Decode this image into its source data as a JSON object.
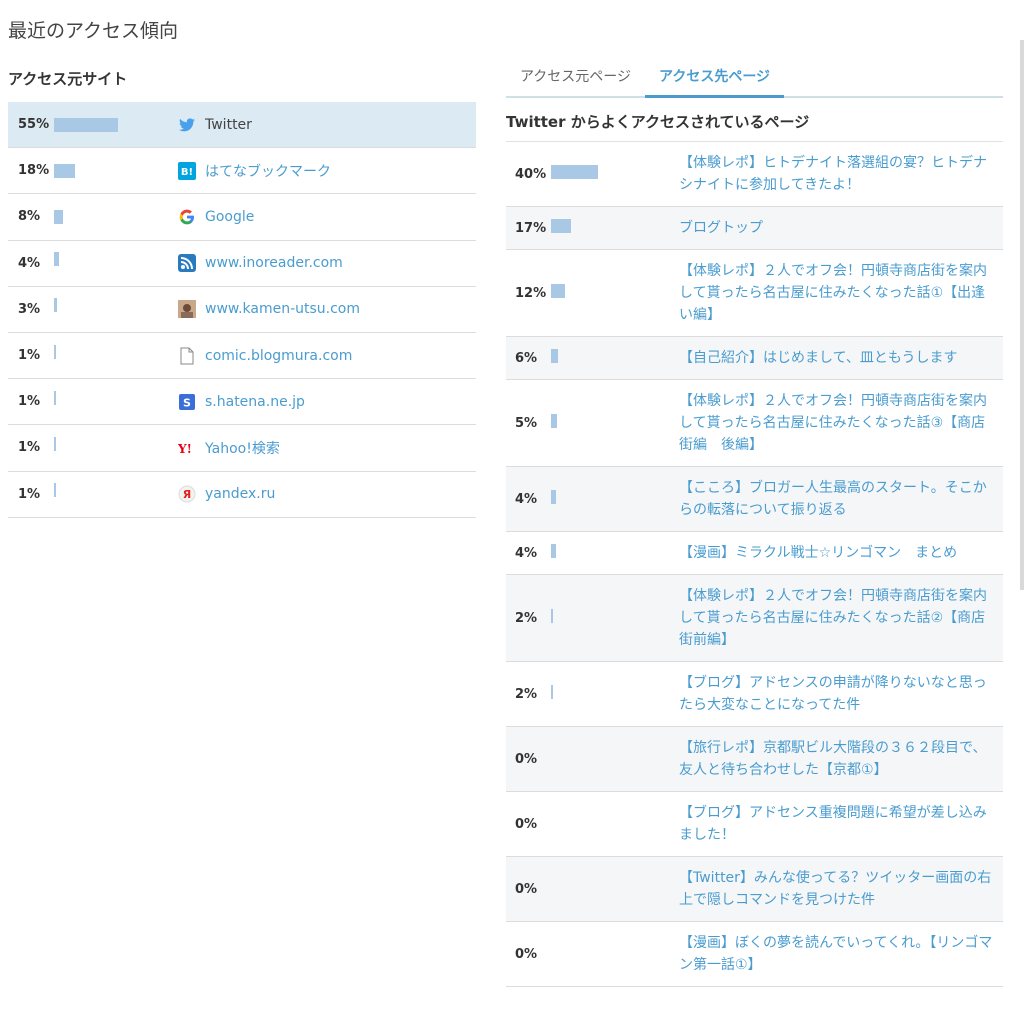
{
  "page": {
    "title": "最近のアクセス傾向"
  },
  "sources": {
    "heading": "アクセス元サイト",
    "items": [
      {
        "percent": "55%",
        "value": 55,
        "name": "Twitter",
        "icon": "twitter-icon",
        "active": true
      },
      {
        "percent": "18%",
        "value": 18,
        "name": "はてなブックマーク",
        "icon": "hatena-bookmark-icon"
      },
      {
        "percent": "8%",
        "value": 8,
        "name": "Google",
        "icon": "google-icon"
      },
      {
        "percent": "4%",
        "value": 4,
        "name": "www.inoreader.com",
        "icon": "rss-icon"
      },
      {
        "percent": "3%",
        "value": 3,
        "name": "www.kamen-utsu.com",
        "icon": "site-favicon-icon"
      },
      {
        "percent": "1%",
        "value": 1,
        "name": "comic.blogmura.com",
        "icon": "document-icon"
      },
      {
        "percent": "1%",
        "value": 1,
        "name": "s.hatena.ne.jp",
        "icon": "hatena-s-icon"
      },
      {
        "percent": "1%",
        "value": 1,
        "name": "Yahoo!検索",
        "icon": "yahoo-icon"
      },
      {
        "percent": "1%",
        "value": 1,
        "name": "yandex.ru",
        "icon": "yandex-icon"
      }
    ]
  },
  "tabs": [
    {
      "label": "アクセス元ページ",
      "active": false
    },
    {
      "label": "アクセス先ページ",
      "active": true
    }
  ],
  "destinations": {
    "heading": "Twitter からよくアクセスされているページ",
    "items": [
      {
        "percent": "40%",
        "value": 40,
        "title": "【体験レポ】ヒトデナイト落選組の宴？ヒトデナシナイトに参加してきたよ！"
      },
      {
        "percent": "17%",
        "value": 17,
        "title": "ブログトップ"
      },
      {
        "percent": "12%",
        "value": 12,
        "title": "【体験レポ】２人でオフ会！円頓寺商店街を案内して貰ったら名古屋に住みたくなった話①【出逢い編】"
      },
      {
        "percent": "6%",
        "value": 6,
        "title": "【自己紹介】はじめまして、皿ともうします"
      },
      {
        "percent": "5%",
        "value": 5,
        "title": "【体験レポ】２人でオフ会！円頓寺商店街を案内して貰ったら名古屋に住みたくなった話③【商店街編　後編】"
      },
      {
        "percent": "4%",
        "value": 4,
        "title": "【こころ】ブロガー人生最高のスタート。そこからの転落について振り返る"
      },
      {
        "percent": "4%",
        "value": 4,
        "title": "【漫画】ミラクル戦士☆リンゴマン　まとめ"
      },
      {
        "percent": "2%",
        "value": 2,
        "title": "【体験レポ】２人でオフ会！円頓寺商店街を案内して貰ったら名古屋に住みたくなった話②【商店街前編】"
      },
      {
        "percent": "2%",
        "value": 2,
        "title": "【ブログ】アドセンスの申請が降りないなと思ったら大変なことになってた件"
      },
      {
        "percent": "0%",
        "value": 0,
        "title": "【旅行レポ】京都駅ビル大階段の３６２段目で、友人と待ち合わせした【京都①】"
      },
      {
        "percent": "0%",
        "value": 0,
        "title": "【ブログ】アドセンス重複問題に希望が差し込みました！"
      },
      {
        "percent": "0%",
        "value": 0,
        "title": "【Twitter】みんな使ってる？ツイッター画面の右上で隠しコマンドを見つけた件"
      },
      {
        "percent": "0%",
        "value": 0,
        "title": "【漫画】ぼくの夢を読んでいってくれ。【リンゴマン第一話①】"
      }
    ]
  },
  "colors": {
    "bar": "#a8c8e6",
    "link": "#4a9ccf",
    "active_row": "#dceaf4",
    "shade_row": "#f5f6f7"
  }
}
